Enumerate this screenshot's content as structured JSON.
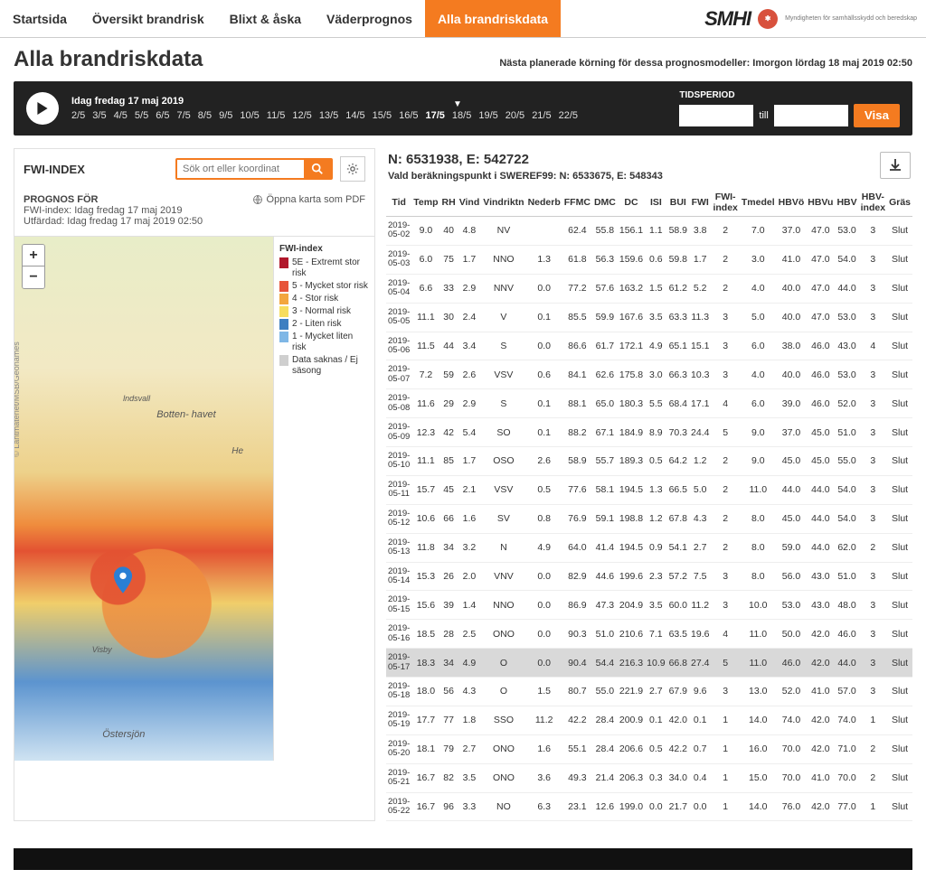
{
  "nav": {
    "items": [
      "Startsida",
      "Översikt brandrisk",
      "Blixt & åska",
      "Väderprognos",
      "Alla brandriskdata"
    ],
    "active_index": 4
  },
  "logo": {
    "smhi": "SMHI",
    "msb_text": "Myndigheten för\nsamhällsskydd\noch beredskap"
  },
  "page": {
    "title": "Alla brandriskdata",
    "next_run": "Nästa planerade körning för dessa prognosmodeller: Imorgon lördag 18 maj 2019 02:50"
  },
  "timeline": {
    "today_label": "Idag fredag 17 maj 2019",
    "dates": [
      "2/5",
      "3/5",
      "4/5",
      "5/5",
      "6/5",
      "7/5",
      "8/5",
      "9/5",
      "10/5",
      "11/5",
      "12/5",
      "13/5",
      "14/5",
      "15/5",
      "16/5",
      "17/5",
      "18/5",
      "19/5",
      "20/5",
      "21/5",
      "22/5"
    ],
    "selected_index": 15,
    "period_label": "TIDSPERIOD",
    "till": "till",
    "from_value": "",
    "to_value": "",
    "visa": "Visa"
  },
  "left": {
    "index_title": "FWI-INDEX",
    "search_placeholder": "Sök ort eller koordinat",
    "prognos_head": "PROGNOS FÖR",
    "prognos_line1": "FWI-index: Idag fredag 17 maj 2019",
    "prognos_line2": "Utfärdad: Idag fredag 17 maj 2019 02:50",
    "open_pdf": "Öppna karta som PDF",
    "map_labels": {
      "bottenhavet": "Botten-\nhavet",
      "ostersjon": "Östersjön",
      "visby": "Visby",
      "he": "He",
      "indsvall": "lndsvall"
    },
    "legend_title": "FWI-index",
    "legend": [
      {
        "color": "#b1172b",
        "label": "5E - Extremt stor risk"
      },
      {
        "color": "#e7543a",
        "label": "5 - Mycket stor risk"
      },
      {
        "color": "#f3a63e",
        "label": "4 - Stor risk"
      },
      {
        "color": "#f7dd5e",
        "label": "3 - Normal risk"
      },
      {
        "color": "#3e7fc1",
        "label": "2 - Liten risk"
      },
      {
        "color": "#7fb7e6",
        "label": "1 - Mycket liten risk"
      },
      {
        "color": "#cfcfcf",
        "label": "Data saknas / Ej säsong"
      }
    ]
  },
  "right": {
    "coord_title": "N: 6531938, E: 542722",
    "coord_sub": "Vald beräkningspunkt i SWEREF99: N: 6533675, E: 548343",
    "columns": [
      "Tid",
      "Temp",
      "RH",
      "Vind",
      "Vindriktn",
      "Nederb",
      "FFMC",
      "DMC",
      "DC",
      "ISI",
      "BUI",
      "FWI",
      "FWI-\nindex",
      "Tmedel",
      "HBVö",
      "HBVu",
      "HBV",
      "HBV-\nindex",
      "Gräs"
    ],
    "highlight_index": 15,
    "rows": [
      {
        "tid": "2019-\n05-02",
        "temp": "9.0",
        "rh": "40",
        "vind": "4.8",
        "dir": "NV",
        "ned": "",
        "ffmc": "62.4",
        "dmc": "55.8",
        "dc": "156.1",
        "isi": "1.1",
        "bui": "58.9",
        "fwi": "3.8",
        "fwii": "2",
        "tmed": "7.0",
        "hbvo": "37.0",
        "hbvu": "47.0",
        "hbv": "53.0",
        "hbvi": "3",
        "gras": "Slut"
      },
      {
        "tid": "2019-\n05-03",
        "temp": "6.0",
        "rh": "75",
        "vind": "1.7",
        "dir": "NNO",
        "ned": "1.3",
        "ffmc": "61.8",
        "dmc": "56.3",
        "dc": "159.6",
        "isi": "0.6",
        "bui": "59.8",
        "fwi": "1.7",
        "fwii": "2",
        "tmed": "3.0",
        "hbvo": "41.0",
        "hbvu": "47.0",
        "hbv": "54.0",
        "hbvi": "3",
        "gras": "Slut"
      },
      {
        "tid": "2019-\n05-04",
        "temp": "6.6",
        "rh": "33",
        "vind": "2.9",
        "dir": "NNV",
        "ned": "0.0",
        "ffmc": "77.2",
        "dmc": "57.6",
        "dc": "163.2",
        "isi": "1.5",
        "bui": "61.2",
        "fwi": "5.2",
        "fwii": "2",
        "tmed": "4.0",
        "hbvo": "40.0",
        "hbvu": "47.0",
        "hbv": "44.0",
        "hbvi": "3",
        "gras": "Slut"
      },
      {
        "tid": "2019-\n05-05",
        "temp": "11.1",
        "rh": "30",
        "vind": "2.4",
        "dir": "V",
        "ned": "0.1",
        "ffmc": "85.5",
        "dmc": "59.9",
        "dc": "167.6",
        "isi": "3.5",
        "bui": "63.3",
        "fwi": "11.3",
        "fwii": "3",
        "tmed": "5.0",
        "hbvo": "40.0",
        "hbvu": "47.0",
        "hbv": "53.0",
        "hbvi": "3",
        "gras": "Slut"
      },
      {
        "tid": "2019-\n05-06",
        "temp": "11.5",
        "rh": "44",
        "vind": "3.4",
        "dir": "S",
        "ned": "0.0",
        "ffmc": "86.6",
        "dmc": "61.7",
        "dc": "172.1",
        "isi": "4.9",
        "bui": "65.1",
        "fwi": "15.1",
        "fwii": "3",
        "tmed": "6.0",
        "hbvo": "38.0",
        "hbvu": "46.0",
        "hbv": "43.0",
        "hbvi": "4",
        "gras": "Slut"
      },
      {
        "tid": "2019-\n05-07",
        "temp": "7.2",
        "rh": "59",
        "vind": "2.6",
        "dir": "VSV",
        "ned": "0.6",
        "ffmc": "84.1",
        "dmc": "62.6",
        "dc": "175.8",
        "isi": "3.0",
        "bui": "66.3",
        "fwi": "10.3",
        "fwii": "3",
        "tmed": "4.0",
        "hbvo": "40.0",
        "hbvu": "46.0",
        "hbv": "53.0",
        "hbvi": "3",
        "gras": "Slut"
      },
      {
        "tid": "2019-\n05-08",
        "temp": "11.6",
        "rh": "29",
        "vind": "2.9",
        "dir": "S",
        "ned": "0.1",
        "ffmc": "88.1",
        "dmc": "65.0",
        "dc": "180.3",
        "isi": "5.5",
        "bui": "68.4",
        "fwi": "17.1",
        "fwii": "4",
        "tmed": "6.0",
        "hbvo": "39.0",
        "hbvu": "46.0",
        "hbv": "52.0",
        "hbvi": "3",
        "gras": "Slut"
      },
      {
        "tid": "2019-\n05-09",
        "temp": "12.3",
        "rh": "42",
        "vind": "5.4",
        "dir": "SO",
        "ned": "0.1",
        "ffmc": "88.2",
        "dmc": "67.1",
        "dc": "184.9",
        "isi": "8.9",
        "bui": "70.3",
        "fwi": "24.4",
        "fwii": "5",
        "tmed": "9.0",
        "hbvo": "37.0",
        "hbvu": "45.0",
        "hbv": "51.0",
        "hbvi": "3",
        "gras": "Slut"
      },
      {
        "tid": "2019-\n05-10",
        "temp": "11.1",
        "rh": "85",
        "vind": "1.7",
        "dir": "OSO",
        "ned": "2.6",
        "ffmc": "58.9",
        "dmc": "55.7",
        "dc": "189.3",
        "isi": "0.5",
        "bui": "64.2",
        "fwi": "1.2",
        "fwii": "2",
        "tmed": "9.0",
        "hbvo": "45.0",
        "hbvu": "45.0",
        "hbv": "55.0",
        "hbvi": "3",
        "gras": "Slut"
      },
      {
        "tid": "2019-\n05-11",
        "temp": "15.7",
        "rh": "45",
        "vind": "2.1",
        "dir": "VSV",
        "ned": "0.5",
        "ffmc": "77.6",
        "dmc": "58.1",
        "dc": "194.5",
        "isi": "1.3",
        "bui": "66.5",
        "fwi": "5.0",
        "fwii": "2",
        "tmed": "11.0",
        "hbvo": "44.0",
        "hbvu": "44.0",
        "hbv": "54.0",
        "hbvi": "3",
        "gras": "Slut"
      },
      {
        "tid": "2019-\n05-12",
        "temp": "10.6",
        "rh": "66",
        "vind": "1.6",
        "dir": "SV",
        "ned": "0.8",
        "ffmc": "76.9",
        "dmc": "59.1",
        "dc": "198.8",
        "isi": "1.2",
        "bui": "67.8",
        "fwi": "4.3",
        "fwii": "2",
        "tmed": "8.0",
        "hbvo": "45.0",
        "hbvu": "44.0",
        "hbv": "54.0",
        "hbvi": "3",
        "gras": "Slut"
      },
      {
        "tid": "2019-\n05-13",
        "temp": "11.8",
        "rh": "34",
        "vind": "3.2",
        "dir": "N",
        "ned": "4.9",
        "ffmc": "64.0",
        "dmc": "41.4",
        "dc": "194.5",
        "isi": "0.9",
        "bui": "54.1",
        "fwi": "2.7",
        "fwii": "2",
        "tmed": "8.0",
        "hbvo": "59.0",
        "hbvu": "44.0",
        "hbv": "62.0",
        "hbvi": "2",
        "gras": "Slut"
      },
      {
        "tid": "2019-\n05-14",
        "temp": "15.3",
        "rh": "26",
        "vind": "2.0",
        "dir": "VNV",
        "ned": "0.0",
        "ffmc": "82.9",
        "dmc": "44.6",
        "dc": "199.6",
        "isi": "2.3",
        "bui": "57.2",
        "fwi": "7.5",
        "fwii": "3",
        "tmed": "8.0",
        "hbvo": "56.0",
        "hbvu": "43.0",
        "hbv": "51.0",
        "hbvi": "3",
        "gras": "Slut"
      },
      {
        "tid": "2019-\n05-15",
        "temp": "15.6",
        "rh": "39",
        "vind": "1.4",
        "dir": "NNO",
        "ned": "0.0",
        "ffmc": "86.9",
        "dmc": "47.3",
        "dc": "204.9",
        "isi": "3.5",
        "bui": "60.0",
        "fwi": "11.2",
        "fwii": "3",
        "tmed": "10.0",
        "hbvo": "53.0",
        "hbvu": "43.0",
        "hbv": "48.0",
        "hbvi": "3",
        "gras": "Slut"
      },
      {
        "tid": "2019-\n05-16",
        "temp": "18.5",
        "rh": "28",
        "vind": "2.5",
        "dir": "ONO",
        "ned": "0.0",
        "ffmc": "90.3",
        "dmc": "51.0",
        "dc": "210.6",
        "isi": "7.1",
        "bui": "63.5",
        "fwi": "19.6",
        "fwii": "4",
        "tmed": "11.0",
        "hbvo": "50.0",
        "hbvu": "42.0",
        "hbv": "46.0",
        "hbvi": "3",
        "gras": "Slut"
      },
      {
        "tid": "2019-\n05-17",
        "temp": "18.3",
        "rh": "34",
        "vind": "4.9",
        "dir": "O",
        "ned": "0.0",
        "ffmc": "90.4",
        "dmc": "54.4",
        "dc": "216.3",
        "isi": "10.9",
        "bui": "66.8",
        "fwi": "27.4",
        "fwii": "5",
        "tmed": "11.0",
        "hbvo": "46.0",
        "hbvu": "42.0",
        "hbv": "44.0",
        "hbvi": "3",
        "gras": "Slut"
      },
      {
        "tid": "2019-\n05-18",
        "temp": "18.0",
        "rh": "56",
        "vind": "4.3",
        "dir": "O",
        "ned": "1.5",
        "ffmc": "80.7",
        "dmc": "55.0",
        "dc": "221.9",
        "isi": "2.7",
        "bui": "67.9",
        "fwi": "9.6",
        "fwii": "3",
        "tmed": "13.0",
        "hbvo": "52.0",
        "hbvu": "41.0",
        "hbv": "57.0",
        "hbvi": "3",
        "gras": "Slut"
      },
      {
        "tid": "2019-\n05-19",
        "temp": "17.7",
        "rh": "77",
        "vind": "1.8",
        "dir": "SSO",
        "ned": "11.2",
        "ffmc": "42.2",
        "dmc": "28.4",
        "dc": "200.9",
        "isi": "0.1",
        "bui": "42.0",
        "fwi": "0.1",
        "fwii": "1",
        "tmed": "14.0",
        "hbvo": "74.0",
        "hbvu": "42.0",
        "hbv": "74.0",
        "hbvi": "1",
        "gras": "Slut"
      },
      {
        "tid": "2019-\n05-20",
        "temp": "18.1",
        "rh": "79",
        "vind": "2.7",
        "dir": "ONO",
        "ned": "1.6",
        "ffmc": "55.1",
        "dmc": "28.4",
        "dc": "206.6",
        "isi": "0.5",
        "bui": "42.2",
        "fwi": "0.7",
        "fwii": "1",
        "tmed": "16.0",
        "hbvo": "70.0",
        "hbvu": "42.0",
        "hbv": "71.0",
        "hbvi": "2",
        "gras": "Slut"
      },
      {
        "tid": "2019-\n05-21",
        "temp": "16.7",
        "rh": "82",
        "vind": "3.5",
        "dir": "ONO",
        "ned": "3.6",
        "ffmc": "49.3",
        "dmc": "21.4",
        "dc": "206.3",
        "isi": "0.3",
        "bui": "34.0",
        "fwi": "0.4",
        "fwii": "1",
        "tmed": "15.0",
        "hbvo": "70.0",
        "hbvu": "41.0",
        "hbv": "70.0",
        "hbvi": "2",
        "gras": "Slut"
      },
      {
        "tid": "2019-\n05-22",
        "temp": "16.7",
        "rh": "96",
        "vind": "3.3",
        "dir": "NO",
        "ned": "6.3",
        "ffmc": "23.1",
        "dmc": "12.6",
        "dc": "199.0",
        "isi": "0.0",
        "bui": "21.7",
        "fwi": "0.0",
        "fwii": "1",
        "tmed": "14.0",
        "hbvo": "76.0",
        "hbvu": "42.0",
        "hbv": "77.0",
        "hbvi": "1",
        "gras": "Slut"
      }
    ]
  }
}
